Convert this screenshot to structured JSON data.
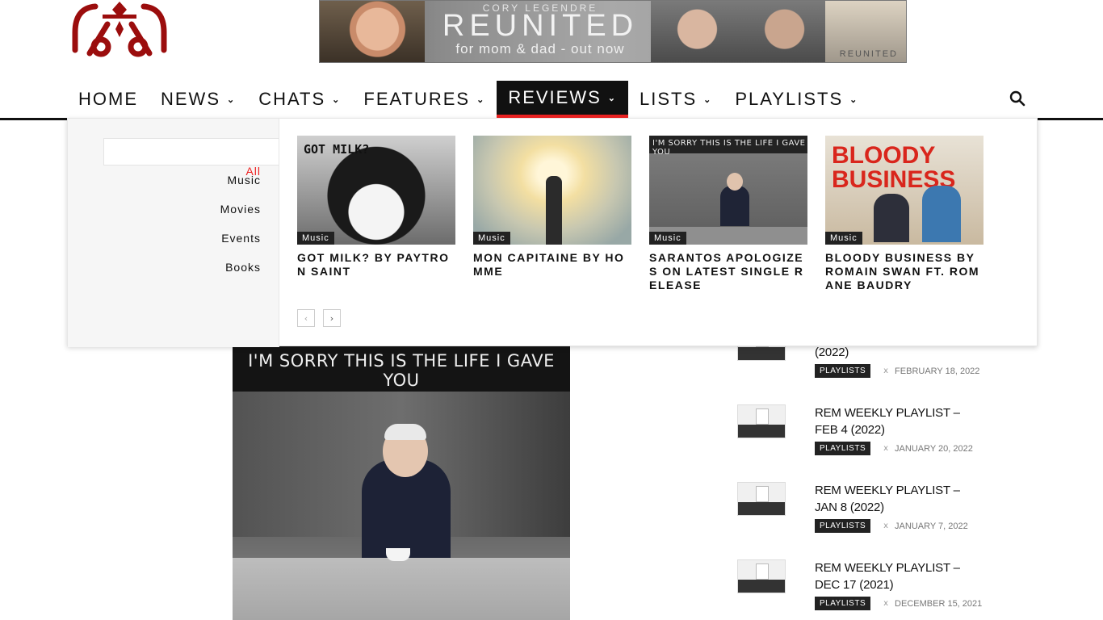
{
  "banner": {
    "artist": "CORY LEGENDRE",
    "title": "REUNITED",
    "subtitle": "for mom & dad - out now",
    "tag": "REUNITED"
  },
  "nav": {
    "items": [
      {
        "label": "HOME",
        "dropdown": false
      },
      {
        "label": "NEWS",
        "dropdown": true
      },
      {
        "label": "CHATS",
        "dropdown": true
      },
      {
        "label": "FEATURES",
        "dropdown": true
      },
      {
        "label": "REVIEWS",
        "dropdown": true,
        "active": true
      },
      {
        "label": "LISTS",
        "dropdown": true
      },
      {
        "label": "PLAYLISTS",
        "dropdown": true
      }
    ],
    "chevron": "⌄"
  },
  "mega": {
    "categories": [
      "All",
      "Music",
      "Movies",
      "Events",
      "Books"
    ],
    "posts": [
      {
        "title": "GOT MILK? BY PAYTRON SAINT",
        "tag": "Music",
        "thumb_text": "GOT MILK?"
      },
      {
        "title": "MON CAPITAINE BY HOMME",
        "tag": "Music"
      },
      {
        "title": "SARANTOS APOLOGIZES ON LATEST SINGLE RELEASE",
        "tag": "Music",
        "thumb_text": "I'M SORRY THIS IS THE LIFE I GAVE YOU"
      },
      {
        "title": "BLOODY BUSINESS BY ROMAIN SWAN FT. ROMANE BAUDRY",
        "tag": "Music",
        "thumb_text": "BLOODY BUSINESS"
      }
    ],
    "prev": "‹",
    "next": "›"
  },
  "hero": {
    "caption": "I'M SORRY THIS IS THE LIFE I GAVE YOU"
  },
  "sidebar": {
    "items": [
      {
        "title": "(2022)",
        "badge": "PLAYLISTS",
        "sep": "x",
        "date": "FEBRUARY 18, 2022"
      },
      {
        "title": "REM WEEKLY PLAYLIST – FEB 4 (2022)",
        "badge": "PLAYLISTS",
        "sep": "x",
        "date": "JANUARY 20, 2022"
      },
      {
        "title": "REM WEEKLY PLAYLIST – JAN 8 (2022)",
        "badge": "PLAYLISTS",
        "sep": "x",
        "date": "JANUARY 7, 2022"
      },
      {
        "title": "REM WEEKLY PLAYLIST – DEC 17 (2021)",
        "badge": "PLAYLISTS",
        "sep": "x",
        "date": "DECEMBER 15, 2021"
      }
    ]
  },
  "colors": {
    "accent": "#ee2222",
    "logo": "#9b0d0d"
  }
}
